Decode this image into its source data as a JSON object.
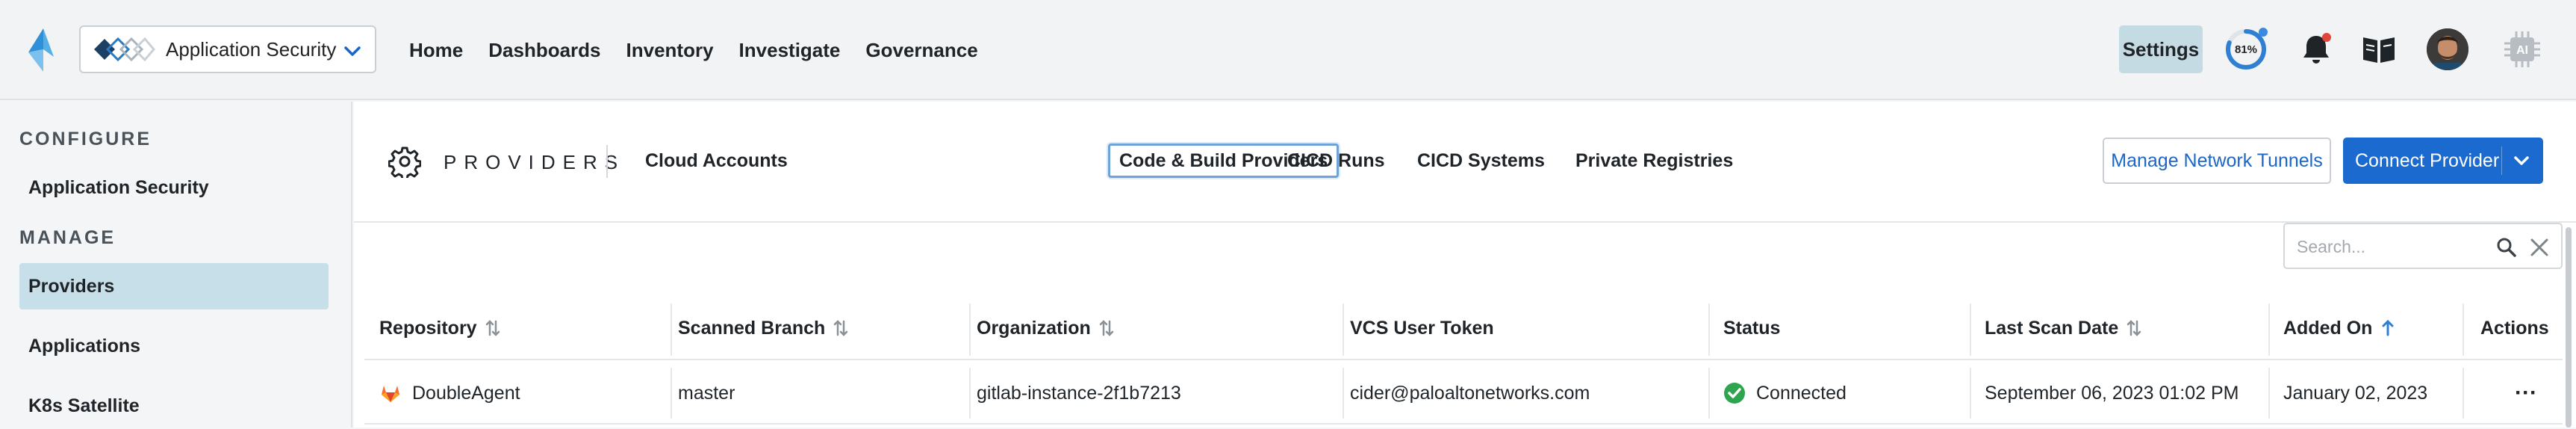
{
  "header": {
    "app_switcher_label": "Application Security",
    "nav": [
      "Home",
      "Dashboards",
      "Inventory",
      "Investigate",
      "Governance"
    ],
    "settings_label": "Settings",
    "progress_label": "81%",
    "progress_value": 0.81
  },
  "sidebar": {
    "configure_heading": "CONFIGURE",
    "configure_items": [
      {
        "label": "Application Security"
      }
    ],
    "manage_heading": "MANAGE",
    "manage_items": [
      {
        "label": "Providers"
      },
      {
        "label": "Applications"
      },
      {
        "label": "K8s Satellite"
      }
    ]
  },
  "page": {
    "title": "PROVIDERS",
    "tabs": [
      "Cloud Accounts",
      "Code & Build Providers",
      "CICD Runs",
      "CICD Systems",
      "Private Registries"
    ],
    "active_tab": "Code & Build Providers",
    "manage_tunnels_label": "Manage Network Tunnels",
    "connect_label": "Connect Provider",
    "search_placeholder": "Search..."
  },
  "table": {
    "columns": [
      "Repository",
      "Scanned Branch",
      "Organization",
      "VCS User Token",
      "Status",
      "Last Scan Date",
      "Added On",
      "Actions"
    ],
    "rows": [
      {
        "repository": "DoubleAgent",
        "branch": "master",
        "organization": "gitlab-instance-2f1b7213",
        "token": "cider@paloaltonetworks.com",
        "status": "Connected",
        "last_scan": "September 06, 2023 01:02 PM",
        "added_on": "January 02, 2023",
        "actions": "···"
      }
    ]
  },
  "colors": {
    "accent": "#1b6ad0",
    "active_side": "#c7dfe8",
    "settings_bg": "#c5dbe3",
    "connected_green": "#2ea44f",
    "gitlab_orange": "#e2432a"
  }
}
